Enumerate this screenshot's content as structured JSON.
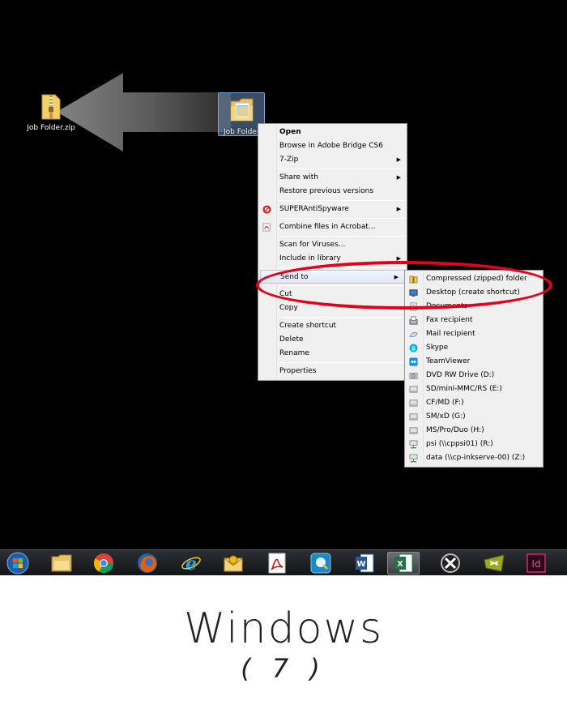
{
  "desktop": {
    "zip_label": "Job Folder.zip",
    "folder_label": "Job Folder"
  },
  "context_menu": {
    "items": [
      {
        "label": "Open",
        "bold": true
      },
      {
        "label": "Browse in Adobe Bridge CS6"
      },
      {
        "label": "7-Zip",
        "submenu": true
      },
      {
        "label": "Share with",
        "submenu": true
      },
      {
        "label": "Restore previous versions"
      },
      {
        "label": "SUPERAntiSpyware",
        "submenu": true,
        "icon": "superantispyware-icon"
      },
      {
        "label": "Combine files in Acrobat...",
        "icon": "acrobat-icon"
      },
      {
        "label": "Scan for Viruses..."
      },
      {
        "label": "Include in library",
        "submenu": true
      },
      {
        "label": "Send to",
        "submenu": true,
        "highlighted": true
      },
      {
        "label": "Cut"
      },
      {
        "label": "Copy"
      },
      {
        "label": "Create shortcut"
      },
      {
        "label": "Delete"
      },
      {
        "label": "Rename"
      },
      {
        "label": "Properties"
      }
    ]
  },
  "send_to_menu": {
    "items": [
      {
        "label": "Compressed (zipped) folder",
        "icon": "zip-folder-icon"
      },
      {
        "label": "Desktop (create shortcut)",
        "icon": "desktop-icon"
      },
      {
        "label": "Documents",
        "icon": "documents-icon"
      },
      {
        "label": "Fax recipient",
        "icon": "fax-icon"
      },
      {
        "label": "Mail recipient",
        "icon": "mail-icon"
      },
      {
        "label": "Skype",
        "icon": "skype-icon"
      },
      {
        "label": "TeamViewer",
        "icon": "teamviewer-icon"
      },
      {
        "label": "DVD RW Drive (D:)",
        "icon": "dvd-drive-icon"
      },
      {
        "label": "SD/mini-MMC/RS (E:)",
        "icon": "drive-icon"
      },
      {
        "label": "CF/MD (F:)",
        "icon": "drive-icon"
      },
      {
        "label": "SM/xD (G:)",
        "icon": "drive-icon"
      },
      {
        "label": "MS/Pro/Duo (H:)",
        "icon": "drive-icon"
      },
      {
        "label": "psi (\\\\cppsi01) (R:)",
        "icon": "network-drive-icon"
      },
      {
        "label": "data (\\\\cp-inkserve-00) (Z:)",
        "icon": "network-drive-icon"
      }
    ]
  },
  "taskbar": {
    "icons": [
      "start-orb-icon",
      "file-explorer-icon",
      "chrome-icon",
      "firefox-icon",
      "internet-explorer-icon",
      "outlook-icon",
      "acrobat-icon",
      "quicktime-icon",
      "word-icon",
      "excel-icon",
      "xara-icon",
      "bridge-icon",
      "indesign-icon"
    ],
    "indesign_text": "Id"
  },
  "caption": {
    "title": "Windows",
    "subtitle": "( 7 )"
  },
  "colors": {
    "highlight_ring": "#e3001b",
    "menu_bg": "#f0f0f0",
    "desktop_bg": "#000000"
  }
}
